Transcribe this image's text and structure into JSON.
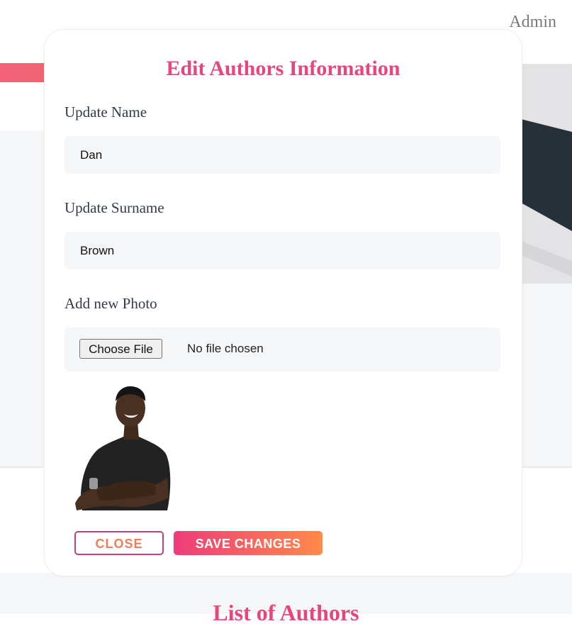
{
  "header": {
    "admin_label": "Admin"
  },
  "modal": {
    "title": "Edit Authors Information",
    "name_label": "Update Name",
    "name_value": "Dan",
    "surname_label": "Update Surname",
    "surname_value": "Brown",
    "photo_label": "Add new Photo",
    "choose_file_label": "Choose File",
    "file_status": "No file chosen",
    "close_label": "CLOSE",
    "save_label": "SAVE CHANGES"
  },
  "background": {
    "section_title": "List of Authors"
  },
  "colors": {
    "accent_pink": "#e8457a",
    "gradient_start": "#ee3c7a",
    "gradient_end": "#ff8a4a",
    "input_bg": "#f5f6f8"
  }
}
